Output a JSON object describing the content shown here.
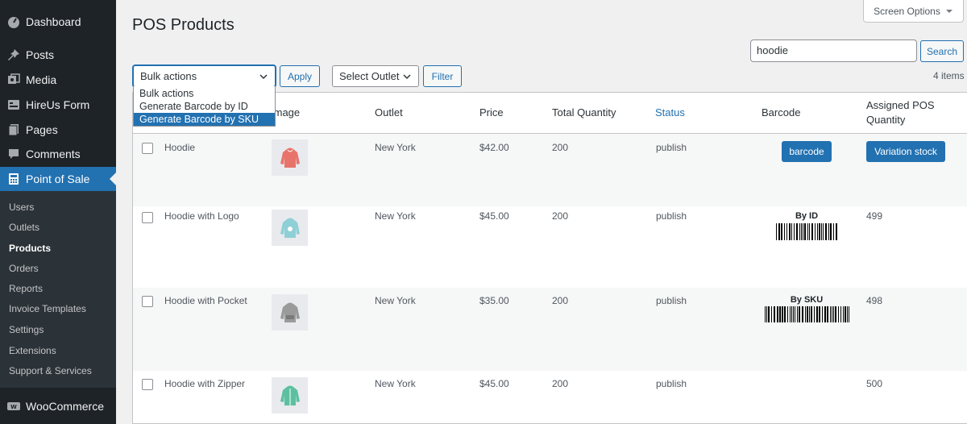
{
  "sidebar": {
    "menu": [
      {
        "label": "Dashboard",
        "icon": "dashboard-icon"
      },
      {
        "label": "Posts",
        "icon": "pin-icon"
      },
      {
        "label": "Media",
        "icon": "media-icon"
      },
      {
        "label": "HireUs Form",
        "icon": "form-icon"
      },
      {
        "label": "Pages",
        "icon": "pages-icon"
      },
      {
        "label": "Comments",
        "icon": "comment-icon"
      },
      {
        "label": "Point of Sale",
        "icon": "calculator-icon"
      }
    ],
    "submenu": [
      "Users",
      "Outlets",
      "Products",
      "Orders",
      "Reports",
      "Invoice Templates",
      "Settings",
      "Extensions",
      "Support & Services"
    ],
    "woocommerce": "WooCommerce"
  },
  "header": {
    "title": "POS Products",
    "screen_options": "Screen Options"
  },
  "search": {
    "value": "hoodie",
    "button": "Search"
  },
  "toolbar": {
    "bulk_actions": "Bulk actions",
    "apply": "Apply",
    "select_outlet": "Select Outlet",
    "filter": "Filter",
    "items_count": "4 items"
  },
  "dropdown": {
    "options": [
      "Bulk actions",
      "Generate Barcode by ID",
      "Generate Barcode by SKU"
    ],
    "selected_index": 2
  },
  "table": {
    "headers": {
      "image": "Image",
      "outlet": "Outlet",
      "price": "Price",
      "total_quantity": "Total Quantity",
      "status": "Status",
      "barcode": "Barcode",
      "assigned_1": "Assigned POS",
      "assigned_2": "Quantity"
    },
    "rows": [
      {
        "name": "Hoodie",
        "outlet": "New York",
        "price": "$42.00",
        "qty": "200",
        "status": "publish",
        "barcode_button": "barcode",
        "assigned_button": "Variation stock",
        "hoodie_color": "#e8736b"
      },
      {
        "name": "Hoodie with Logo",
        "outlet": "New York",
        "price": "$45.00",
        "qty": "200",
        "status": "publish",
        "barcode_label": "By ID",
        "assigned": "499",
        "hoodie_color": "#8fcfd6"
      },
      {
        "name": "Hoodie with Pocket",
        "outlet": "New York",
        "price": "$35.00",
        "qty": "200",
        "status": "publish",
        "barcode_label": "By SKU",
        "assigned": "498",
        "hoodie_color": "#9a9a9a"
      },
      {
        "name": "Hoodie with Zipper",
        "outlet": "New York",
        "price": "$45.00",
        "qty": "200",
        "status": "publish",
        "assigned": "500",
        "hoodie_color": "#5cc0a0"
      }
    ]
  },
  "colors": {
    "accent": "#2271b1",
    "sidebar": "#1d2327"
  }
}
